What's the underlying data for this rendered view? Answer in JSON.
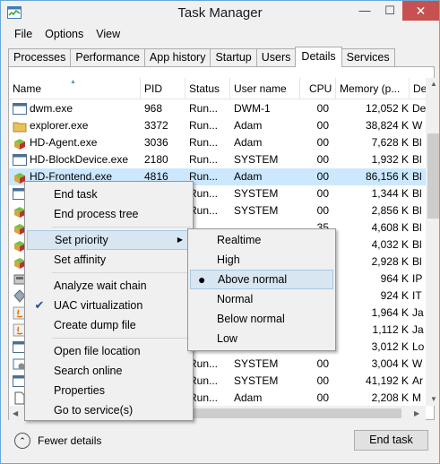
{
  "window": {
    "title": "Task Manager"
  },
  "titlebar": {
    "minimize": "—",
    "maximize": "☐",
    "close": "✕"
  },
  "menu": [
    "File",
    "Options",
    "View"
  ],
  "tabs": [
    "Processes",
    "Performance",
    "App history",
    "Startup",
    "Users",
    "Details",
    "Services"
  ],
  "active_tab": "Details",
  "columns": [
    "Name",
    "PID",
    "Status",
    "User name",
    "CPU",
    "Memory (p...",
    "De"
  ],
  "rows": [
    {
      "icon": "window-icon",
      "name": "dwm.exe",
      "pid": "968",
      "status": "Run...",
      "user": "DWM-1",
      "cpu": "00",
      "memory": "12,052 K",
      "desc": "De"
    },
    {
      "icon": "folder-icon",
      "name": "explorer.exe",
      "pid": "3372",
      "status": "Run...",
      "user": "Adam",
      "cpu": "00",
      "memory": "38,824 K",
      "desc": "W"
    },
    {
      "icon": "blocks-icon",
      "name": "HD-Agent.exe",
      "pid": "3036",
      "status": "Run...",
      "user": "Adam",
      "cpu": "00",
      "memory": "7,628 K",
      "desc": "Bl"
    },
    {
      "icon": "window-icon",
      "name": "HD-BlockDevice.exe",
      "pid": "2180",
      "status": "Run...",
      "user": "SYSTEM",
      "cpu": "00",
      "memory": "1,932 K",
      "desc": "Bl"
    },
    {
      "icon": "blocks-icon",
      "name": "HD-Frontend.exe",
      "pid": "4816",
      "status": "Run...",
      "user": "Adam",
      "cpu": "00",
      "memory": "86,156 K",
      "desc": "Bl",
      "selected": true
    },
    {
      "icon": "window-icon",
      "name": "",
      "pid": "",
      "status": "Run...",
      "user": "SYSTEM",
      "cpu": "00",
      "memory": "1,344 K",
      "desc": "Bl"
    },
    {
      "icon": "blocks-icon",
      "name": "",
      "pid": "",
      "status": "Run...",
      "user": "SYSTEM",
      "cpu": "00",
      "memory": "2,856 K",
      "desc": "Bl"
    },
    {
      "icon": "blocks-icon",
      "name": "",
      "pid": "",
      "status": "",
      "user": "",
      "cpu": "",
      "memory": "4,608 K",
      "desc": "Bl"
    },
    {
      "icon": "blocks-icon",
      "name": "",
      "pid": "",
      "status": "",
      "user": "",
      "cpu": "",
      "memory": "4,032 K",
      "desc": "Bl"
    },
    {
      "icon": "blocks-icon",
      "name": "",
      "pid": "",
      "status": "",
      "user": "",
      "cpu": "",
      "memory": "2,928 K",
      "desc": "Bl"
    },
    {
      "icon": "tools-icon",
      "name": "",
      "pid": "",
      "status": "",
      "user": "",
      "cpu": "",
      "memory": "964 K",
      "desc": "IP"
    },
    {
      "icon": "diamond-icon",
      "name": "",
      "pid": "",
      "status": "",
      "user": "",
      "cpu": "",
      "memory": "924 K",
      "desc": "IT"
    },
    {
      "icon": "java-icon",
      "name": "",
      "pid": "",
      "status": "",
      "user": "",
      "cpu": "",
      "memory": "1,964 K",
      "desc": "Ja"
    },
    {
      "icon": "java-icon",
      "name": "",
      "pid": "",
      "status": "",
      "user": "",
      "cpu": "",
      "memory": "1,112 K",
      "desc": "Ja"
    },
    {
      "icon": "window-icon",
      "name": "",
      "pid": "",
      "status": "",
      "user": "",
      "cpu": "",
      "memory": "3,012 K",
      "desc": "Lo"
    },
    {
      "icon": "service-icon",
      "name": "",
      "pid": "",
      "status": "Run...",
      "user": "SYSTEM",
      "cpu": "00",
      "memory": "3,004 K",
      "desc": "W"
    },
    {
      "icon": "window-icon",
      "name": "",
      "pid": "",
      "status": "Run...",
      "user": "SYSTEM",
      "cpu": "00",
      "memory": "41,192 K",
      "desc": "Ar"
    },
    {
      "icon": "document-icon",
      "name": "",
      "pid": "",
      "status": "Run...",
      "user": "Adam",
      "cpu": "00",
      "memory": "2,208 K",
      "desc": "M"
    }
  ],
  "row3_cpu_partial": "35",
  "context_menu": {
    "items": [
      {
        "label": "End task"
      },
      {
        "label": "End process tree"
      },
      {
        "sep": true
      },
      {
        "label": "Set priority",
        "submenu": true,
        "hover": true
      },
      {
        "label": "Set affinity"
      },
      {
        "sep": true
      },
      {
        "label": "Analyze wait chain"
      },
      {
        "label": "UAC virtualization",
        "checked": true
      },
      {
        "label": "Create dump file"
      },
      {
        "sep": true
      },
      {
        "label": "Open file location"
      },
      {
        "label": "Search online"
      },
      {
        "label": "Properties"
      },
      {
        "label": "Go to service(s)"
      }
    ],
    "check_glyph": "✔",
    "submenu_glyph": "▶"
  },
  "priority_menu": {
    "items": [
      {
        "label": "Realtime"
      },
      {
        "label": "High"
      },
      {
        "label": "Above normal",
        "selected": true,
        "hover": true
      },
      {
        "label": "Normal"
      },
      {
        "label": "Below normal"
      },
      {
        "label": "Low"
      }
    ],
    "selected_glyph": "●"
  },
  "footer": {
    "fewer_details": "Fewer details",
    "end_task": "End task"
  },
  "colors": {
    "selection": "#cce8ff",
    "close_button": "#c75050",
    "window_border": "#6aa8d8"
  }
}
